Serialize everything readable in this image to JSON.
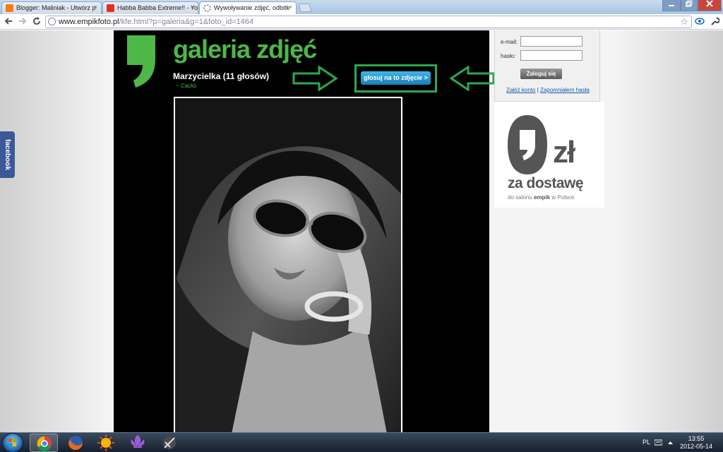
{
  "browser": {
    "tabs": [
      {
        "label": "Blogger: Maliniak - Utwórz p",
        "icon": "blogger-icon"
      },
      {
        "label": "Habba Babba Extreme!! - Yo",
        "icon": "youtube-icon"
      },
      {
        "label": "Wywoływanie zdjęć, odbitk",
        "icon": "loading-icon"
      }
    ],
    "close_glyph": "×",
    "address": {
      "domain": "www.empikfoto.pl",
      "path": "/kfe.html?p=galeria&g=1&foto_id=1464"
    }
  },
  "page": {
    "facebook_tab": "facebook",
    "gallery_title": "galeria zdjęć",
    "photo_title": "Marzycielka (11 głosów)",
    "photo_author": "~ Cacko",
    "vote_button": "głosuj na to zdjęcie >",
    "login": {
      "email_label": "e-mail:",
      "password_label": "hasło:",
      "login_button": "Zaloguj się",
      "register_link": "Załóż konto",
      "separator": "|",
      "forgot_link": "Zapomniałem hasła"
    },
    "promo": {
      "price_suffix": "zł",
      "headline": "za dostawę",
      "subline_prefix": "do salonu",
      "brand": "empik",
      "subline_suffix": "w Polsce"
    }
  },
  "taskbar": {
    "language": "PL",
    "time": "13:55",
    "date": "2012-05-14",
    "apps": [
      "chrome-icon",
      "firefox-icon",
      "sun-icon",
      "fleur-de-lis-icon",
      "sword-icon"
    ]
  },
  "colors": {
    "brand_green": "#4db848",
    "highlight_green": "#2ea84d",
    "vote_blue": "#1b7fb8",
    "facebook_blue": "#3b5998"
  }
}
